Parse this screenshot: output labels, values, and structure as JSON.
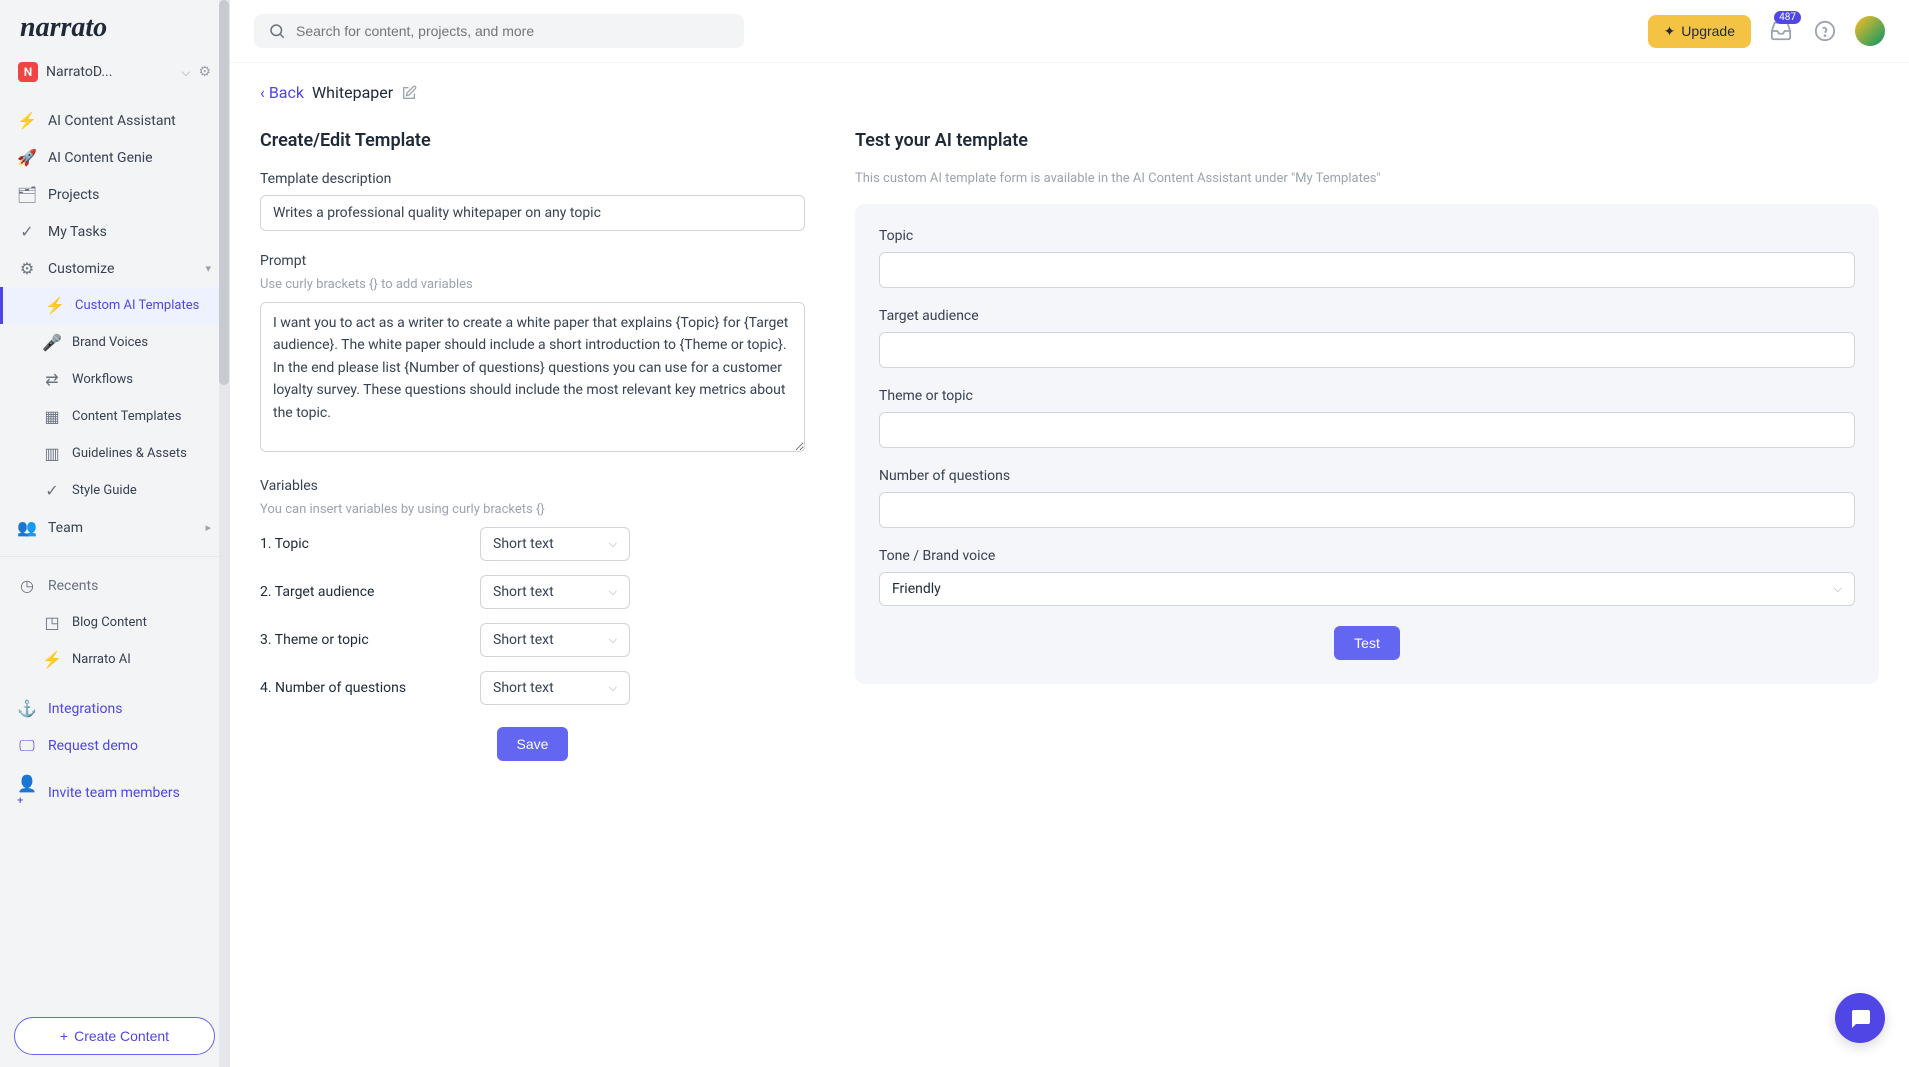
{
  "workspace": {
    "initial": "N",
    "name": "NarratoD..."
  },
  "search": {
    "placeholder": "Search for content, projects, and more"
  },
  "topbar": {
    "upgrade": "Upgrade",
    "badge": "487"
  },
  "sidebar": {
    "items": [
      {
        "label": "AI Content Assistant"
      },
      {
        "label": "AI Content Genie"
      },
      {
        "label": "Projects"
      },
      {
        "label": "My Tasks"
      },
      {
        "label": "Customize"
      },
      {
        "label": "Custom AI Templates"
      },
      {
        "label": "Brand Voices"
      },
      {
        "label": "Workflows"
      },
      {
        "label": "Content Templates"
      },
      {
        "label": "Guidelines & Assets"
      },
      {
        "label": "Style Guide"
      },
      {
        "label": "Team"
      }
    ],
    "recents_header": "Recents",
    "recents": [
      {
        "label": "Blog Content"
      },
      {
        "label": "Narrato AI"
      }
    ],
    "footer": [
      {
        "label": "Integrations"
      },
      {
        "label": "Request demo"
      },
      {
        "label": "Invite team members"
      }
    ],
    "create": "Create Content"
  },
  "breadcrumb": {
    "back": "Back",
    "title": "Whitepaper"
  },
  "form": {
    "heading": "Create/Edit Template",
    "desc_label": "Template description",
    "desc_value": "Writes a professional quality whitepaper on any topic",
    "prompt_label": "Prompt",
    "prompt_hint": "Use curly brackets {} to add variables",
    "prompt_value": "I want you to act as a writer to create a white paper that explains {Topic} for {Target audience}. The white paper should include a short introduction to {Theme or topic}. In the end please list {Number of questions} questions you can use for a customer loyalty survey. These questions should include the most relevant key metrics about the topic.",
    "vars_label": "Variables",
    "vars_hint": "You can insert variables by using curly brackets {}",
    "vars": [
      {
        "n": "1.",
        "name": "Topic",
        "type": "Short text"
      },
      {
        "n": "2.",
        "name": "Target audience",
        "type": "Short text"
      },
      {
        "n": "3.",
        "name": "Theme or topic",
        "type": "Short text"
      },
      {
        "n": "4.",
        "name": "Number of questions",
        "type": "Short text"
      }
    ],
    "save": "Save"
  },
  "test": {
    "heading": "Test your AI template",
    "hint": "This custom AI template form is available in the AI Content Assistant under \"My Templates\"",
    "fields": [
      {
        "label": "Topic"
      },
      {
        "label": "Target audience"
      },
      {
        "label": "Theme or topic"
      },
      {
        "label": "Number of questions"
      }
    ],
    "tone_label": "Tone / Brand voice",
    "tone_value": "Friendly",
    "button": "Test"
  }
}
